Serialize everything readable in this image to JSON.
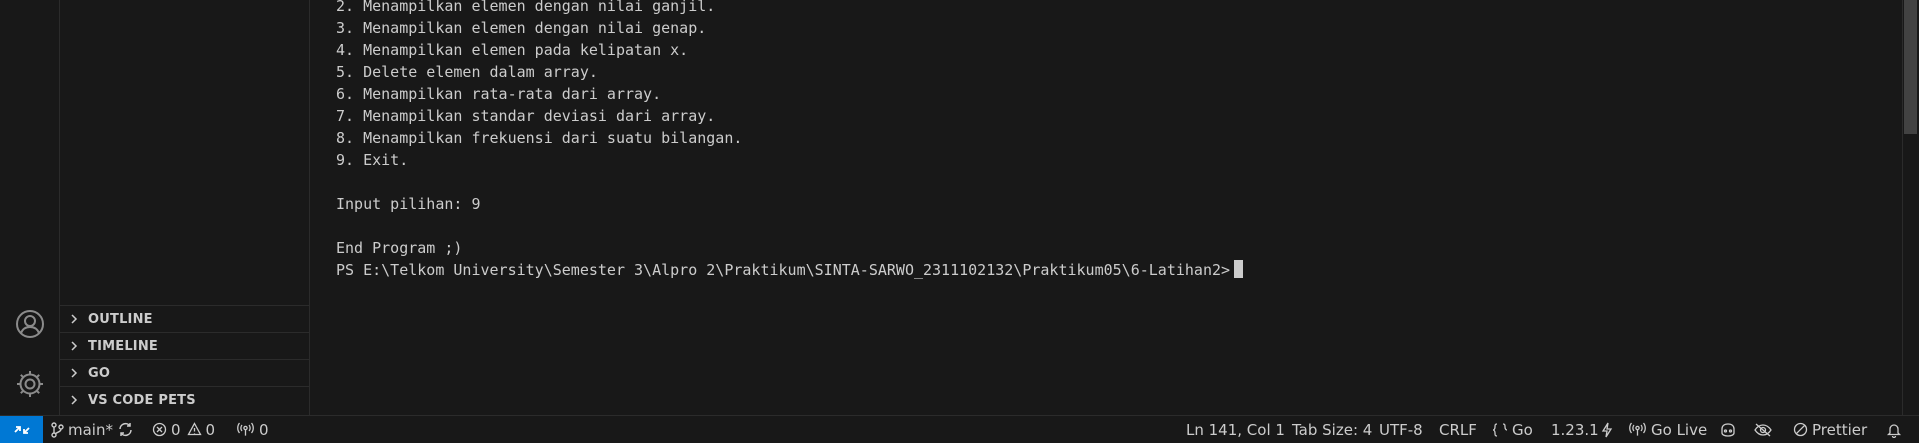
{
  "sidebar": {
    "sections": [
      {
        "label": "OUTLINE"
      },
      {
        "label": "TIMELINE"
      },
      {
        "label": "GO"
      },
      {
        "label": "VS CODE PETS"
      }
    ]
  },
  "terminal": {
    "lines": [
      "2. Menampilkan elemen dengan nilai ganjil.",
      "3. Menampilkan elemen dengan nilai genap.",
      "4. Menampilkan elemen pada kelipatan x.",
      "5. Delete elemen dalam array.",
      "6. Menampilkan rata-rata dari array.",
      "7. Menampilkan standar deviasi dari array.",
      "8. Menampilkan frekuensi dari suatu bilangan.",
      "9. Exit.",
      "",
      "Input pilihan: 9",
      "",
      "End Program ;)",
      "PS E:\\Telkom University\\Semester 3\\Alpro 2\\Praktikum\\SINTA-SARWO_2311102132\\Praktikum05\\6-Latihan2>"
    ]
  },
  "statusbar": {
    "branch": "main*",
    "errors": "0",
    "warnings": "0",
    "ports": "0",
    "position": "Ln 141, Col 1",
    "tab_size": "Tab Size: 4",
    "encoding": "UTF-8",
    "eol": "CRLF",
    "language": "Go",
    "go_version": "1.23.1",
    "go_live": "Go Live",
    "prettier": "Prettier"
  },
  "colors": {
    "background": "#181818",
    "remote_accent": "#0078d4",
    "text": "#cccccc"
  }
}
